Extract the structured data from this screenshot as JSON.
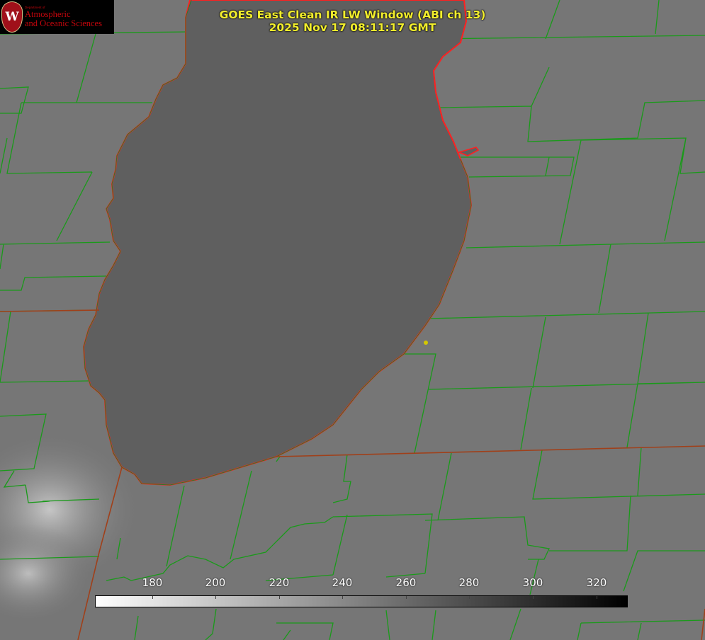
{
  "product": {
    "title_line1": "GOES East Clean IR LW Window (ABI ch 13)",
    "title_line2": "2025 Nov 17 08:11:17 GMT"
  },
  "logo": {
    "department": "Department of",
    "line1": "Atmospheric",
    "line2": "and Oceanic Sciences",
    "seal_letter": "W"
  },
  "colorbar": {
    "ticks": [
      "180",
      "200",
      "220",
      "240",
      "260",
      "280",
      "300",
      "320"
    ],
    "range_low_color": "#ffffff",
    "range_high_color": "#000000"
  },
  "map": {
    "land_color": "#767676",
    "lake_color": "#5f5f5f",
    "shoreline_color": "#ff2020",
    "county_line_color": "#1a9a1a",
    "state_line_color": "#a0401a",
    "station_marker_color": "#d4c800"
  }
}
